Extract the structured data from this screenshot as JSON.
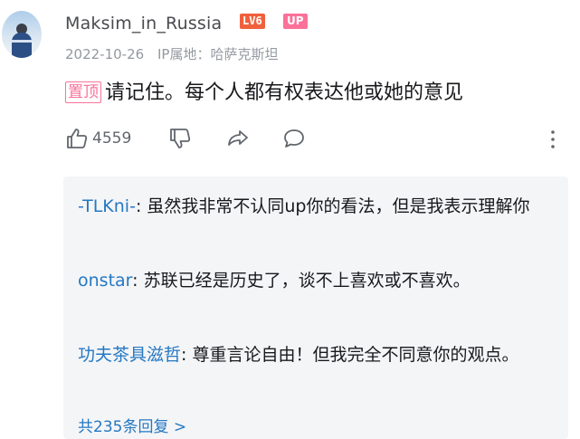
{
  "user": {
    "name": "Maksim_in_Russia",
    "level_badge": "LV6",
    "up_badge": "UP"
  },
  "meta": {
    "date": "2022-10-26",
    "ip_location": "IP属地：哈萨克斯坦"
  },
  "comment": {
    "pin_label": "置顶",
    "text": "请记住。每个人都有权表达他或她的意见"
  },
  "actions": {
    "like_count": "4559",
    "icons": [
      "thumb-up-icon",
      "thumb-down-icon",
      "share-icon",
      "reply-icon",
      "more-icon"
    ]
  },
  "replies": [
    {
      "name": "-TLKni-",
      "text": ": 虽然我非常不认同up你的看法，但是我表示理解你"
    },
    {
      "name": "onstar",
      "text": ": 苏联已经是历史了，谈不上喜欢或不喜欢。"
    },
    {
      "name": "功夫茶具滋哲",
      "text": ": 尊重言论自由！但我完全不同意你的观点。"
    }
  ],
  "more_replies": "共235条回复 >",
  "colors": {
    "link_blue": "#2478c3",
    "pink": "#fb7299",
    "level_orange": "#f0603c",
    "gray_text": "#9499a0"
  }
}
